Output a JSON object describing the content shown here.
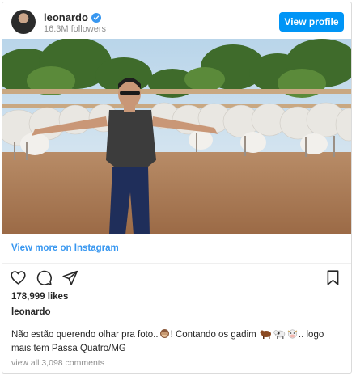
{
  "header": {
    "username": "leonardo",
    "followers": "16.3M followers",
    "view_profile_label": "View profile",
    "verified": true
  },
  "post": {
    "view_more_label": "View more on Instagram",
    "likes": "178,999 likes",
    "owner": "leonardo",
    "caption_part1": "Não estão querendo olhar pra foto..",
    "caption_part2": "! Contando os gadim ",
    "caption_part3": ".. logo mais tem Passa Quatro/MG",
    "view_comments": "view all 3,098 comments"
  },
  "icons": {
    "verified": "verified-badge-icon",
    "like": "heart-icon",
    "comment": "comment-icon",
    "share": "share-icon",
    "save": "bookmark-icon"
  },
  "colors": {
    "accent": "#0095f6",
    "link": "#3897f0",
    "muted": "#8e8e8e",
    "border": "#dbdbdb"
  }
}
